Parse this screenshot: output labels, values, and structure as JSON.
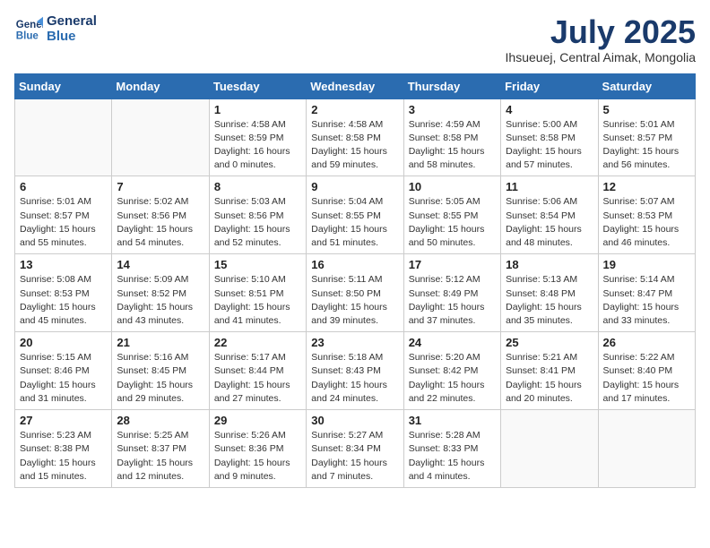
{
  "header": {
    "logo_line1": "General",
    "logo_line2": "Blue",
    "month_title": "July 2025",
    "subtitle": "Ihsueuej, Central Aimak, Mongolia"
  },
  "weekdays": [
    "Sunday",
    "Monday",
    "Tuesday",
    "Wednesday",
    "Thursday",
    "Friday",
    "Saturday"
  ],
  "weeks": [
    [
      {
        "day": "",
        "info": ""
      },
      {
        "day": "",
        "info": ""
      },
      {
        "day": "1",
        "info": "Sunrise: 4:58 AM\nSunset: 8:59 PM\nDaylight: 16 hours\nand 0 minutes."
      },
      {
        "day": "2",
        "info": "Sunrise: 4:58 AM\nSunset: 8:58 PM\nDaylight: 15 hours\nand 59 minutes."
      },
      {
        "day": "3",
        "info": "Sunrise: 4:59 AM\nSunset: 8:58 PM\nDaylight: 15 hours\nand 58 minutes."
      },
      {
        "day": "4",
        "info": "Sunrise: 5:00 AM\nSunset: 8:58 PM\nDaylight: 15 hours\nand 57 minutes."
      },
      {
        "day": "5",
        "info": "Sunrise: 5:01 AM\nSunset: 8:57 PM\nDaylight: 15 hours\nand 56 minutes."
      }
    ],
    [
      {
        "day": "6",
        "info": "Sunrise: 5:01 AM\nSunset: 8:57 PM\nDaylight: 15 hours\nand 55 minutes."
      },
      {
        "day": "7",
        "info": "Sunrise: 5:02 AM\nSunset: 8:56 PM\nDaylight: 15 hours\nand 54 minutes."
      },
      {
        "day": "8",
        "info": "Sunrise: 5:03 AM\nSunset: 8:56 PM\nDaylight: 15 hours\nand 52 minutes."
      },
      {
        "day": "9",
        "info": "Sunrise: 5:04 AM\nSunset: 8:55 PM\nDaylight: 15 hours\nand 51 minutes."
      },
      {
        "day": "10",
        "info": "Sunrise: 5:05 AM\nSunset: 8:55 PM\nDaylight: 15 hours\nand 50 minutes."
      },
      {
        "day": "11",
        "info": "Sunrise: 5:06 AM\nSunset: 8:54 PM\nDaylight: 15 hours\nand 48 minutes."
      },
      {
        "day": "12",
        "info": "Sunrise: 5:07 AM\nSunset: 8:53 PM\nDaylight: 15 hours\nand 46 minutes."
      }
    ],
    [
      {
        "day": "13",
        "info": "Sunrise: 5:08 AM\nSunset: 8:53 PM\nDaylight: 15 hours\nand 45 minutes."
      },
      {
        "day": "14",
        "info": "Sunrise: 5:09 AM\nSunset: 8:52 PM\nDaylight: 15 hours\nand 43 minutes."
      },
      {
        "day": "15",
        "info": "Sunrise: 5:10 AM\nSunset: 8:51 PM\nDaylight: 15 hours\nand 41 minutes."
      },
      {
        "day": "16",
        "info": "Sunrise: 5:11 AM\nSunset: 8:50 PM\nDaylight: 15 hours\nand 39 minutes."
      },
      {
        "day": "17",
        "info": "Sunrise: 5:12 AM\nSunset: 8:49 PM\nDaylight: 15 hours\nand 37 minutes."
      },
      {
        "day": "18",
        "info": "Sunrise: 5:13 AM\nSunset: 8:48 PM\nDaylight: 15 hours\nand 35 minutes."
      },
      {
        "day": "19",
        "info": "Sunrise: 5:14 AM\nSunset: 8:47 PM\nDaylight: 15 hours\nand 33 minutes."
      }
    ],
    [
      {
        "day": "20",
        "info": "Sunrise: 5:15 AM\nSunset: 8:46 PM\nDaylight: 15 hours\nand 31 minutes."
      },
      {
        "day": "21",
        "info": "Sunrise: 5:16 AM\nSunset: 8:45 PM\nDaylight: 15 hours\nand 29 minutes."
      },
      {
        "day": "22",
        "info": "Sunrise: 5:17 AM\nSunset: 8:44 PM\nDaylight: 15 hours\nand 27 minutes."
      },
      {
        "day": "23",
        "info": "Sunrise: 5:18 AM\nSunset: 8:43 PM\nDaylight: 15 hours\nand 24 minutes."
      },
      {
        "day": "24",
        "info": "Sunrise: 5:20 AM\nSunset: 8:42 PM\nDaylight: 15 hours\nand 22 minutes."
      },
      {
        "day": "25",
        "info": "Sunrise: 5:21 AM\nSunset: 8:41 PM\nDaylight: 15 hours\nand 20 minutes."
      },
      {
        "day": "26",
        "info": "Sunrise: 5:22 AM\nSunset: 8:40 PM\nDaylight: 15 hours\nand 17 minutes."
      }
    ],
    [
      {
        "day": "27",
        "info": "Sunrise: 5:23 AM\nSunset: 8:38 PM\nDaylight: 15 hours\nand 15 minutes."
      },
      {
        "day": "28",
        "info": "Sunrise: 5:25 AM\nSunset: 8:37 PM\nDaylight: 15 hours\nand 12 minutes."
      },
      {
        "day": "29",
        "info": "Sunrise: 5:26 AM\nSunset: 8:36 PM\nDaylight: 15 hours\nand 9 minutes."
      },
      {
        "day": "30",
        "info": "Sunrise: 5:27 AM\nSunset: 8:34 PM\nDaylight: 15 hours\nand 7 minutes."
      },
      {
        "day": "31",
        "info": "Sunrise: 5:28 AM\nSunset: 8:33 PM\nDaylight: 15 hours\nand 4 minutes."
      },
      {
        "day": "",
        "info": ""
      },
      {
        "day": "",
        "info": ""
      }
    ]
  ]
}
